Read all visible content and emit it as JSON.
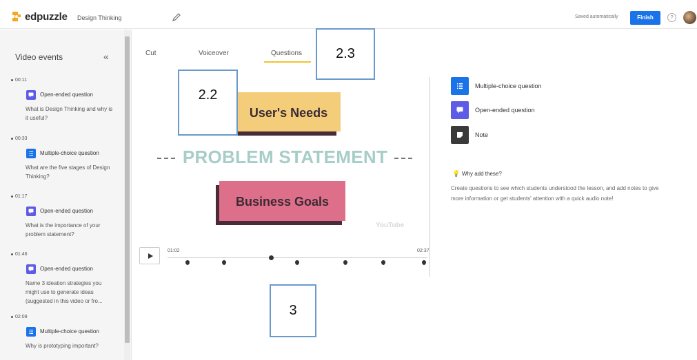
{
  "header": {
    "brand": "edpuzzle",
    "project_title": "Design Thinking",
    "saved_status": "Saved automatically",
    "finish_label": "Finish",
    "help_glyph": "?",
    "icons": [
      "edpuzzle-logo-icon",
      "pencil-icon",
      "help-icon",
      "avatar"
    ]
  },
  "sidebar": {
    "title": "Video events",
    "collapse_glyph": "«",
    "events": [
      {
        "time": "00:11",
        "type": "Open-ended question",
        "icon": "open-ended-question-icon",
        "text": "What is Design Thinking and why is it useful?"
      },
      {
        "time": "00:33",
        "type": "Multiple-choice question",
        "icon": "multiple-choice-question-icon",
        "text": "What are the five stages of Design Thinking?"
      },
      {
        "time": "01:17",
        "type": "Open-ended question",
        "icon": "open-ended-question-icon",
        "text": "What is the importance of your problem statement?"
      },
      {
        "time": "01:46",
        "type": "Open-ended question",
        "icon": "open-ended-question-icon",
        "text": "Name 3 ideation strategies you might use to generate ideas (suggested in this video or fro..."
      },
      {
        "time": "02:09",
        "type": "Multiple-choice question",
        "icon": "multiple-choice-question-icon",
        "text": "Why is prototyping important?"
      }
    ]
  },
  "tabs": [
    {
      "label": "Cut"
    },
    {
      "label": "Voiceover"
    },
    {
      "label": "Questions",
      "active": true
    }
  ],
  "annotations": [
    "2.3",
    "2.2",
    "3"
  ],
  "video": {
    "card_top": "User's Needs",
    "headline": "PROBLEM STATEMENT",
    "card_bottom": "Business Goals",
    "watermark": "YouTube"
  },
  "player": {
    "current_time": "01:02",
    "end_time": "02:37",
    "progress_fraction": 0.4
  },
  "add_panel": {
    "items": [
      {
        "label": "Multiple-choice question",
        "icon": "multiple-choice-question-icon"
      },
      {
        "label": "Open-ended question",
        "icon": "open-ended-question-icon"
      },
      {
        "label": "Note",
        "icon": "note-icon"
      }
    ],
    "why_title": "Why add these?",
    "why_text": "Create questions to see which students understood the lesson, and add notes to give more information or get students' attention with a quick audio note!"
  },
  "colors": {
    "accent_blue": "#1a73e8",
    "open_ended_purple": "#5e5ce6",
    "active_tab_underline": "#f2c230",
    "card_yellow": "#f3cd79",
    "card_pink": "#dd6f8a",
    "headline_teal": "#a7cdc8",
    "annotation_border": "#6a9acb"
  }
}
